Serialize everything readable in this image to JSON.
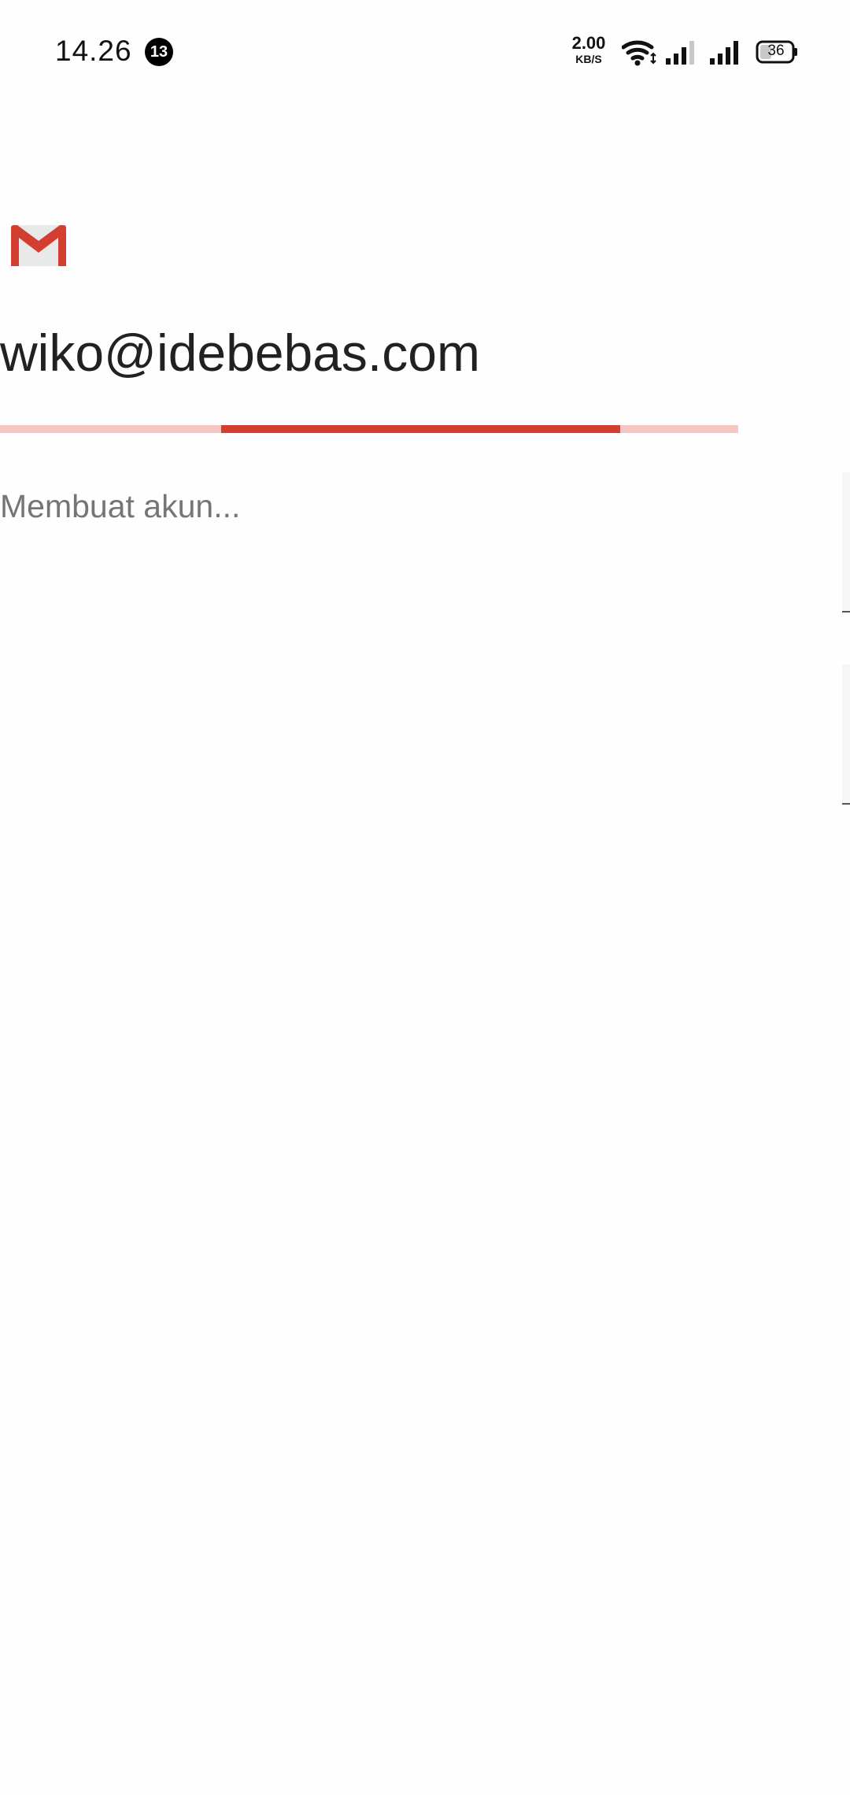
{
  "status_bar": {
    "time": "14.26",
    "notification_count": "13",
    "net_speed_value": "2.00",
    "net_speed_unit": "KB/S",
    "battery_level": "36",
    "icons": [
      "wifi-icon",
      "signal-icon",
      "signal-icon",
      "battery-icon"
    ]
  },
  "app": {
    "logo": "gmail-logo",
    "account_email": "wiko@idebebas.com",
    "status_message": "Membuat akun...",
    "progress": {
      "type": "indeterminate",
      "indicator_start": 0.3,
      "indicator_end": 0.84
    }
  },
  "colors": {
    "accent": "#d23f31",
    "progress_track": "#f4c7c3",
    "text_primary": "#212121",
    "text_secondary": "#757575",
    "background": "#fefefe"
  }
}
